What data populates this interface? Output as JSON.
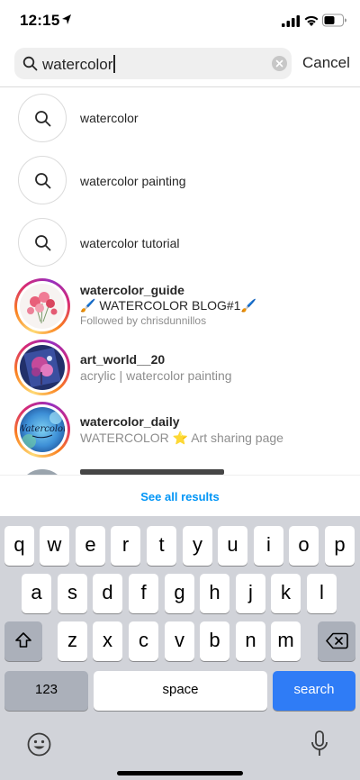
{
  "status_bar": {
    "time": "12:15"
  },
  "search": {
    "value": "watercolor",
    "cancel_label": "Cancel"
  },
  "queries": [
    {
      "label": "watercolor"
    },
    {
      "label": "watercolor painting"
    },
    {
      "label": "watercolor tutorial"
    }
  ],
  "accounts": [
    {
      "username": "watercolor_guide",
      "bio": "🖌️ WATERCOLOR BLOG#1🖌️",
      "followed_by": "Followed by chrisdunnillos"
    },
    {
      "username": "art_world__20",
      "bio": "acrylic | watercolor painting"
    },
    {
      "username": "watercolor_daily",
      "bio": "WATERCOLOR ⭐ Art sharing page",
      "avatar_text": "Watercolor"
    }
  ],
  "see_all": {
    "label": "See all results"
  },
  "keyboard": {
    "row1": [
      "q",
      "w",
      "e",
      "r",
      "t",
      "y",
      "u",
      "i",
      "o",
      "p"
    ],
    "row2": [
      "a",
      "s",
      "d",
      "f",
      "g",
      "h",
      "j",
      "k",
      "l"
    ],
    "row3": [
      "z",
      "x",
      "c",
      "v",
      "b",
      "n",
      "m"
    ],
    "numbers_label": "123",
    "space_label": "space",
    "search_label": "search"
  },
  "colors": {
    "link_blue": "#0095f6",
    "search_key_blue": "#2f7cf6"
  }
}
